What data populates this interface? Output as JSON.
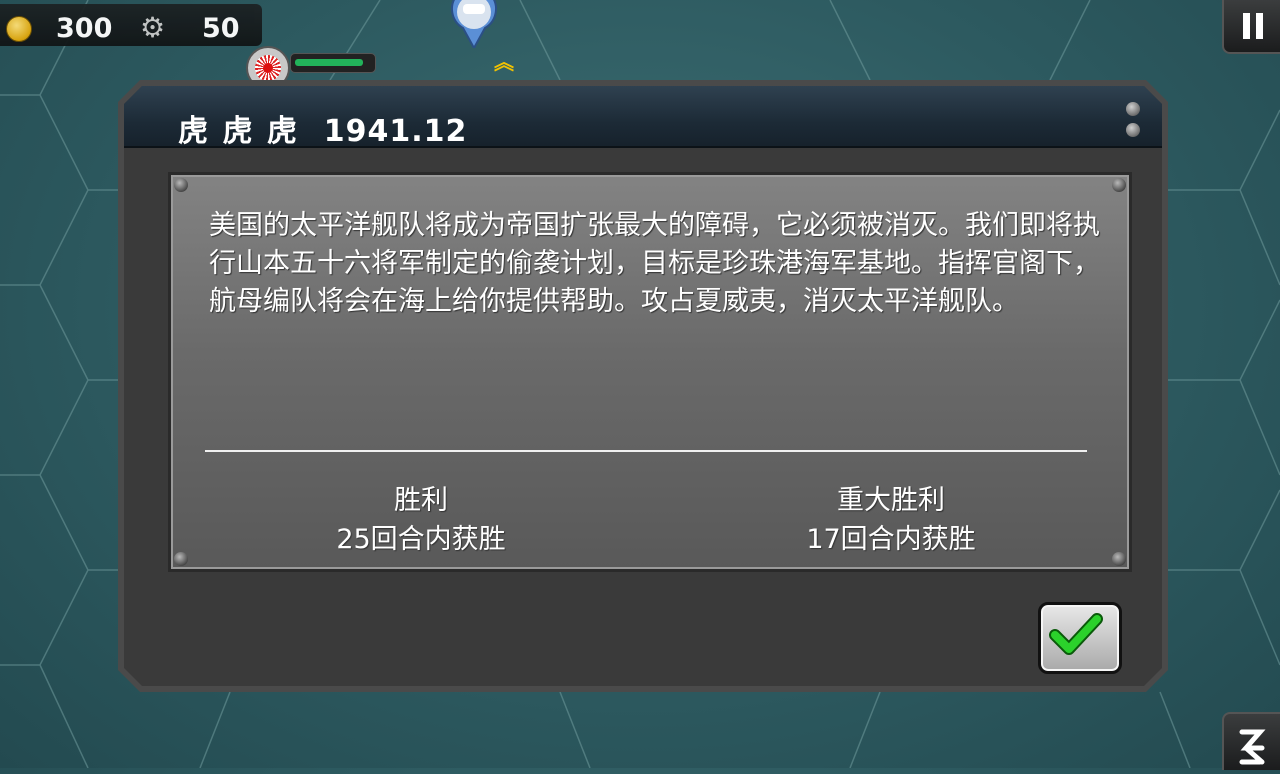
{
  "hud": {
    "gold": "300",
    "industry": "50",
    "unit_hp_fraction": 0.9
  },
  "dialog": {
    "title": "虎 虎 虎",
    "date": "1941.12",
    "description": "美国的太平洋舰队将成为帝国扩张最大的障碍，它必须被消灭。我们即将执行山本五十六将军制定的偷袭计划，目标是珍珠港海军基地。指挥官阁下，航母编队将会在海上给你提供帮助。攻占夏威夷，消灭太平洋舰队。",
    "victory": {
      "label": "胜利",
      "condition": "25回合内获胜"
    },
    "major_victory": {
      "label": "重大胜利",
      "condition": "17回合内获胜"
    }
  },
  "icons": {
    "gold": "gold-coin-icon",
    "industry": "gear-icon",
    "pause": "pause-icon",
    "confirm": "checkmark-icon",
    "corner": "menu-icon"
  },
  "colors": {
    "header": "#1c2a36",
    "panel": "#6a6a6a",
    "confirm_green": "#22c322",
    "hp_green": "#22b35a",
    "rank_gold": "#f2c200"
  }
}
